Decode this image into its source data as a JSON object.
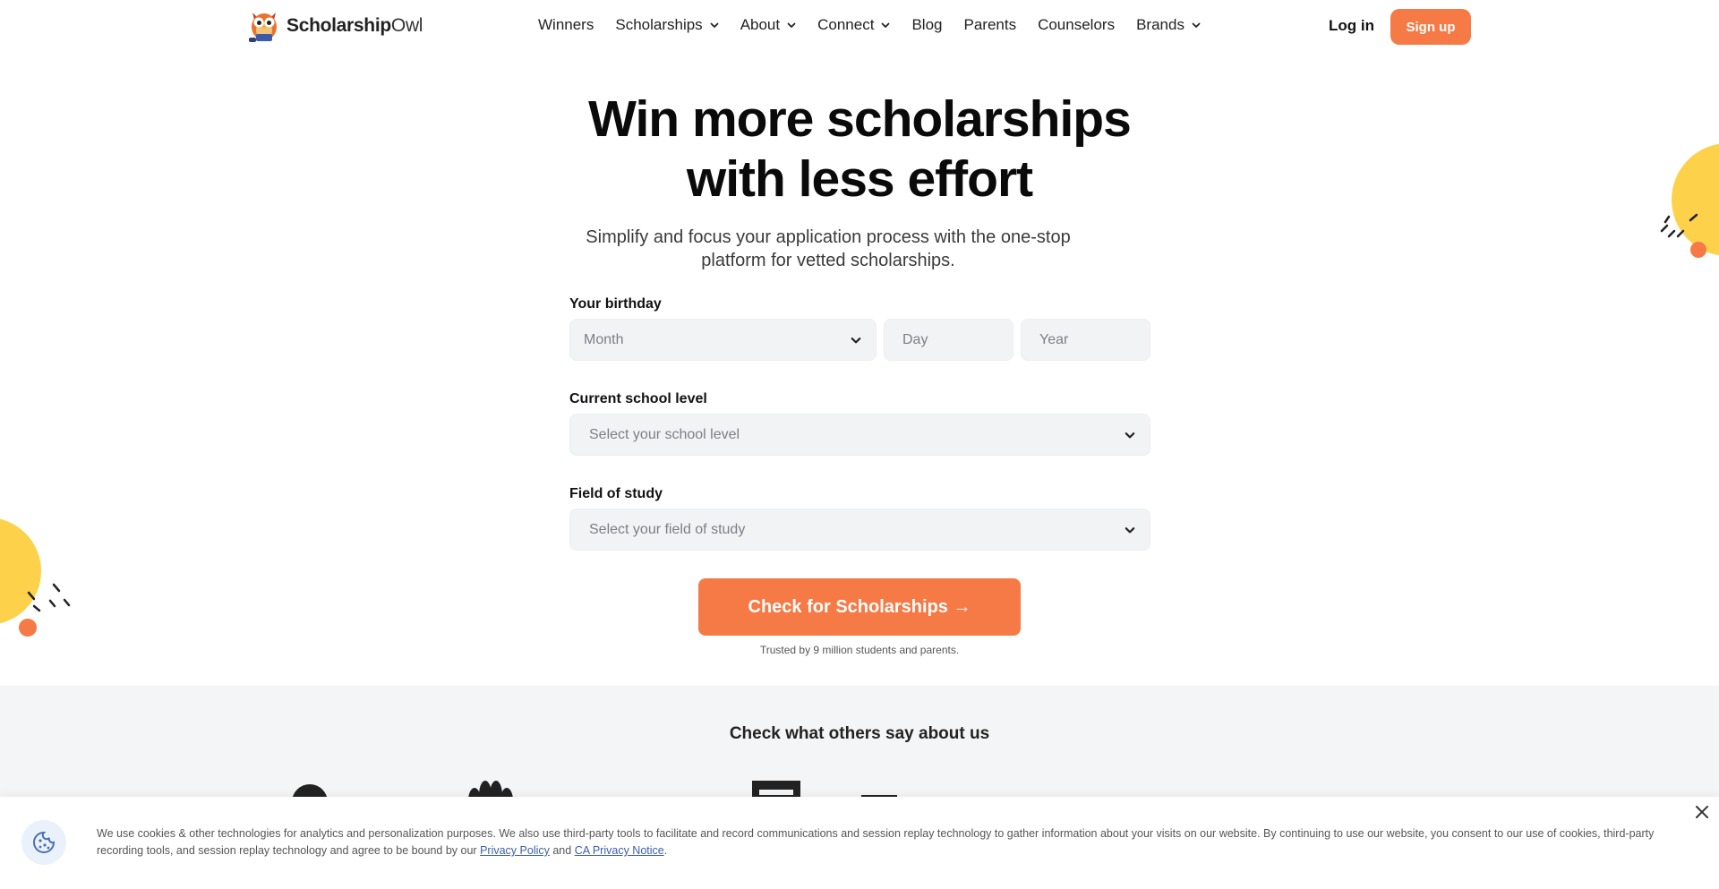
{
  "header": {
    "logo_bold": "Scholarship",
    "logo_light": "Owl",
    "nav": [
      {
        "label": "Winners",
        "dropdown": false
      },
      {
        "label": "Scholarships",
        "dropdown": true
      },
      {
        "label": "About",
        "dropdown": true
      },
      {
        "label": "Connect",
        "dropdown": true
      },
      {
        "label": "Blog",
        "dropdown": false
      },
      {
        "label": "Parents",
        "dropdown": false
      },
      {
        "label": "Counselors",
        "dropdown": false
      },
      {
        "label": "Brands",
        "dropdown": true
      }
    ],
    "login_label": "Log in",
    "signup_label": "Sign up"
  },
  "hero": {
    "title_line1": "Win more scholarships",
    "title_line2": "with less effort",
    "subtitle": "Simplify and focus your application process with the one-stop platform for vetted scholarships."
  },
  "form": {
    "birthday_label": "Your birthday",
    "month_placeholder": "Month",
    "day_placeholder": "Day",
    "year_placeholder": "Year",
    "school_label": "Current school level",
    "school_placeholder": "Select your school level",
    "study_label": "Field of study",
    "study_placeholder": "Select your field of study",
    "cta_label": "Check for Scholarships →",
    "trusted_text": "Trusted by 9 million students and parents."
  },
  "others": {
    "title": "Check what others say about us"
  },
  "cookie": {
    "text_main": "We use cookies & other technologies for analytics and personalization purposes. We also use third-party tools to facilitate and record communications and session replay technology to gather information about your visits on our website. By continuing to use our website, you consent to our use of cookies, third-party recording tools, and session replay technology and agree to be bound by our ",
    "privacy_link": "Privacy Policy",
    "and_text": " and ",
    "ca_link": "CA Privacy Notice",
    "end_text": "."
  },
  "colors": {
    "accent": "#f57a45",
    "yellow": "#fdd24a",
    "field_bg": "#f2f3f5",
    "section_bg": "#f4f5f7"
  }
}
